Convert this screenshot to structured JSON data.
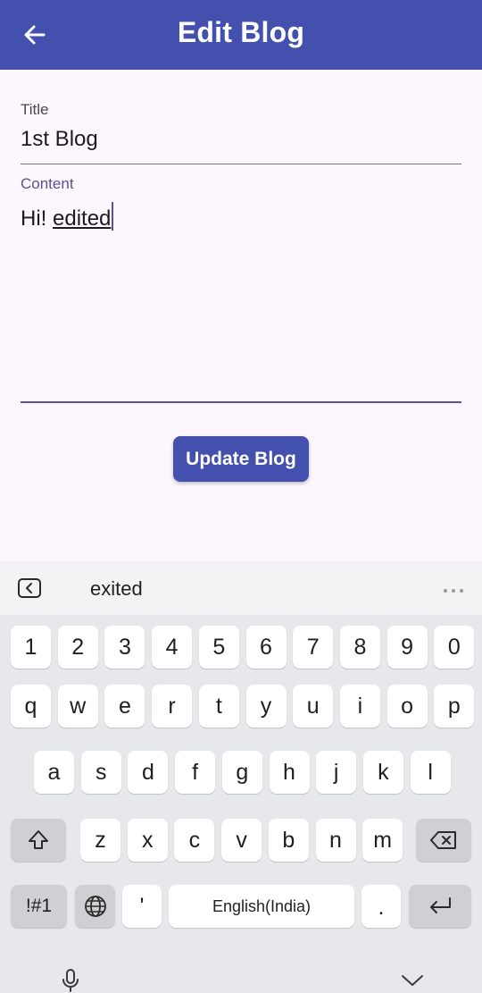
{
  "appbar": {
    "title": "Edit Blog",
    "back_icon": "arrow-back-icon"
  },
  "form": {
    "title_label": "Title",
    "title_value": "1st Blog",
    "content_label": "Content",
    "content_plain": "Hi! ",
    "content_composing": "edited",
    "update_button": "Update Blog"
  },
  "keyboard": {
    "suggestion": "exited",
    "row_numbers": [
      "1",
      "2",
      "3",
      "4",
      "5",
      "6",
      "7",
      "8",
      "9",
      "0"
    ],
    "row_top": [
      "q",
      "w",
      "e",
      "r",
      "t",
      "y",
      "u",
      "i",
      "o",
      "p"
    ],
    "row_middle": [
      "a",
      "s",
      "d",
      "f",
      "g",
      "h",
      "j",
      "k",
      "l"
    ],
    "row_bottom": [
      "z",
      "x",
      "c",
      "v",
      "b",
      "n",
      "m"
    ],
    "symbols_key": "!#1",
    "apostrophe_key": "'",
    "space_key": "English(India)",
    "period_key": "."
  },
  "colors": {
    "appbar": "#4350ae",
    "accent": "#5c4ea0",
    "background": "#fcf7fc",
    "keyboard_bg": "#e7e8ec"
  }
}
